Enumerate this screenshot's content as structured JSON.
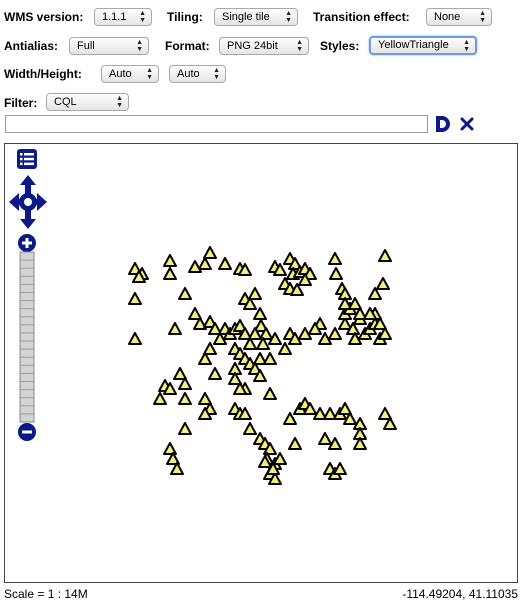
{
  "options": {
    "wms_version": {
      "label": "WMS version:",
      "value": "1.1.1"
    },
    "tiling": {
      "label": "Tiling:",
      "value": "Single tile"
    },
    "transition": {
      "label": "Transition effect:",
      "value": "None"
    },
    "antialias": {
      "label": "Antialias:",
      "value": "Full"
    },
    "format": {
      "label": "Format:",
      "value": "PNG 24bit"
    },
    "styles": {
      "label": "Styles:",
      "value": "YellowTriangle"
    },
    "width_height": {
      "label": "Width/Height:",
      "width_value": "Auto",
      "height_value": "Auto"
    },
    "filter": {
      "label": "Filter:",
      "value": "CQL"
    }
  },
  "filter_input": {
    "value": ""
  },
  "map": {
    "controls": {
      "layer_switcher_icon": "list-icon",
      "pan_icon": "four-arrow-pan-icon",
      "zoom_in_icon": "plus-icon",
      "zoom_out_icon": "minus-icon",
      "zoom_levels": 21
    },
    "colors": {
      "marker_fill": "#f3ef7a",
      "marker_stroke": "#000000",
      "control_blue": "#0b1a87"
    }
  },
  "status_bar": {
    "scale": "Scale = 1 : 14M",
    "coordinates": "-114.49204, 41.11035"
  }
}
